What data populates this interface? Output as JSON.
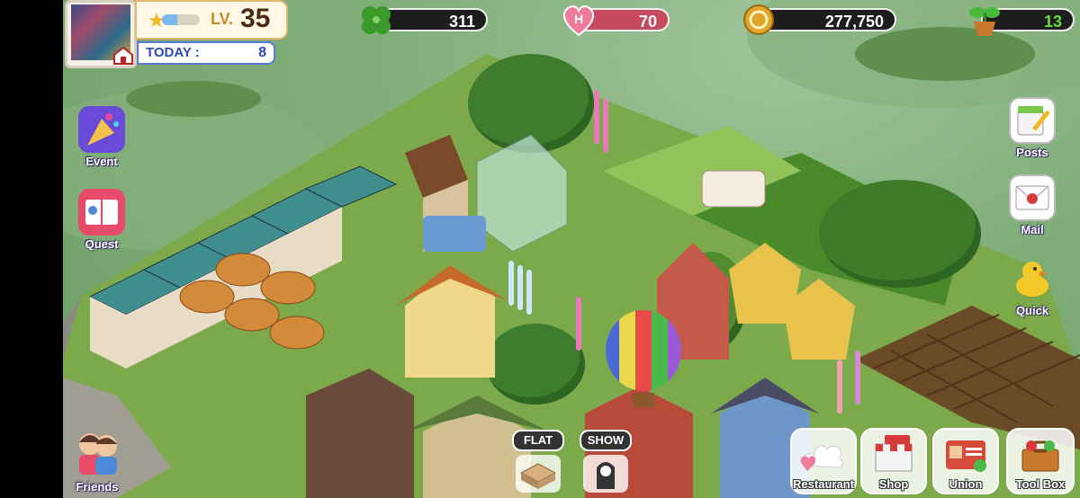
{
  "player": {
    "level_label": "LV.",
    "level": "35",
    "today_label": "TODAY :",
    "today_value": "8"
  },
  "resources": {
    "clover": "311",
    "hearts": "70",
    "coins": "277,750",
    "sprouts": "13"
  },
  "left_menu": [
    {
      "label": "Event",
      "icon": "party-popper-icon"
    },
    {
      "label": "Quest",
      "icon": "quest-book-icon"
    }
  ],
  "right_menu": [
    {
      "label": "Posts",
      "icon": "notepad-pencil-icon"
    },
    {
      "label": "Mail",
      "icon": "envelope-icon"
    },
    {
      "label": "Quick",
      "icon": "duck-icon"
    }
  ],
  "bottom_left": {
    "label": "Friends",
    "icon": "friends-icon"
  },
  "view_toggles": {
    "flat": "FLAT",
    "show": "SHOW"
  },
  "bottom_menu": [
    {
      "label": "Restaurant",
      "icon": "chef-hat-icon"
    },
    {
      "label": "Shop",
      "icon": "shop-icon"
    },
    {
      "label": "Union",
      "icon": "union-card-icon"
    },
    {
      "label": "Tool Box",
      "icon": "toolbox-icon"
    }
  ],
  "colors": {
    "hud_dark": "#1d1d1d",
    "heart_bar": "#c84a5e",
    "coin": "#e0a52a",
    "clover": "#3a9a2a"
  }
}
